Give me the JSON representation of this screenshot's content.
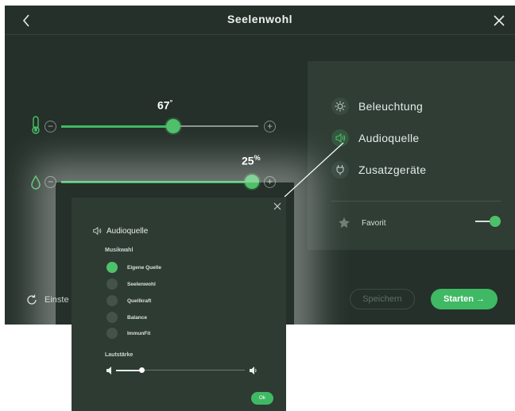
{
  "header": {
    "title": "Seelenwohl"
  },
  "temperature": {
    "value": "67",
    "unit": "°",
    "level": 0.57
  },
  "humidity": {
    "value": "25",
    "unit": "%",
    "level": 1.0
  },
  "side_menu": {
    "items": [
      {
        "label": "Beleuchtung",
        "icon": "sun-icon"
      },
      {
        "label": "Audioquelle",
        "icon": "speaker-icon"
      },
      {
        "label": "Zusatzgeräte",
        "icon": "plug-icon"
      }
    ],
    "favorite_label": "Favorit",
    "favorite_on": true
  },
  "footer": {
    "settings_label": "Einste",
    "save_label": "Speichern",
    "start_label": "Starten →"
  },
  "popup": {
    "title": "Audioquelle",
    "music_section": "Musikwahl",
    "options": [
      {
        "label": "Eigene Quelle",
        "selected": true
      },
      {
        "label": "Seelenwohl",
        "selected": false
      },
      {
        "label": "Quellkraft",
        "selected": false
      },
      {
        "label": "Balance",
        "selected": false
      },
      {
        "label": "ImmunFit",
        "selected": false
      }
    ],
    "volume_section": "Lautstärke",
    "volume_level": 0.2,
    "ok_label": "Ok"
  },
  "colors": {
    "accent": "#3fb964",
    "background": "#243029",
    "panel": "#2f3d35"
  }
}
